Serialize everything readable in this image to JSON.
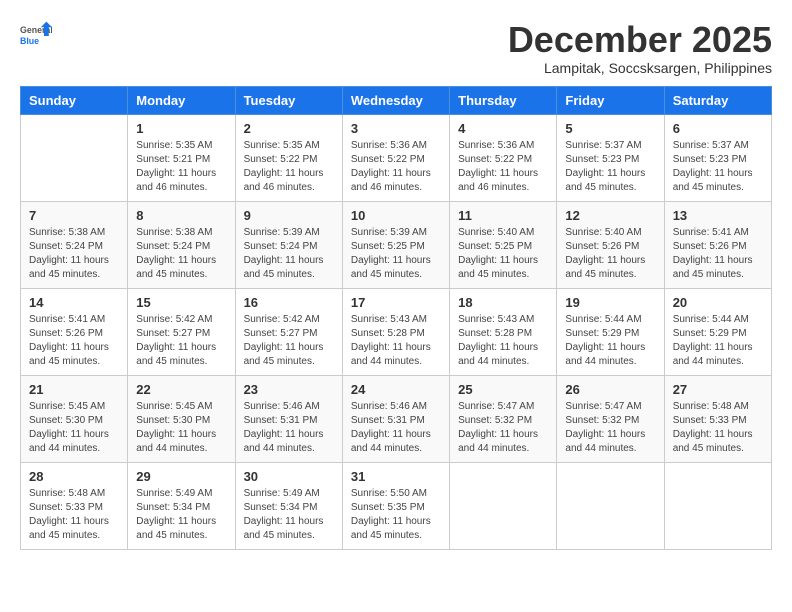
{
  "logo": {
    "general": "General",
    "blue": "Blue"
  },
  "title": "December 2025",
  "location": "Lampitak, Soccsksargen, Philippines",
  "weekdays": [
    "Sunday",
    "Monday",
    "Tuesday",
    "Wednesday",
    "Thursday",
    "Friday",
    "Saturday"
  ],
  "weeks": [
    [
      {
        "day": "",
        "info": ""
      },
      {
        "day": "1",
        "info": "Sunrise: 5:35 AM\nSunset: 5:21 PM\nDaylight: 11 hours and 46 minutes."
      },
      {
        "day": "2",
        "info": "Sunrise: 5:35 AM\nSunset: 5:22 PM\nDaylight: 11 hours and 46 minutes."
      },
      {
        "day": "3",
        "info": "Sunrise: 5:36 AM\nSunset: 5:22 PM\nDaylight: 11 hours and 46 minutes."
      },
      {
        "day": "4",
        "info": "Sunrise: 5:36 AM\nSunset: 5:22 PM\nDaylight: 11 hours and 46 minutes."
      },
      {
        "day": "5",
        "info": "Sunrise: 5:37 AM\nSunset: 5:23 PM\nDaylight: 11 hours and 45 minutes."
      },
      {
        "day": "6",
        "info": "Sunrise: 5:37 AM\nSunset: 5:23 PM\nDaylight: 11 hours and 45 minutes."
      }
    ],
    [
      {
        "day": "7",
        "info": "Sunrise: 5:38 AM\nSunset: 5:24 PM\nDaylight: 11 hours and 45 minutes."
      },
      {
        "day": "8",
        "info": "Sunrise: 5:38 AM\nSunset: 5:24 PM\nDaylight: 11 hours and 45 minutes."
      },
      {
        "day": "9",
        "info": "Sunrise: 5:39 AM\nSunset: 5:24 PM\nDaylight: 11 hours and 45 minutes."
      },
      {
        "day": "10",
        "info": "Sunrise: 5:39 AM\nSunset: 5:25 PM\nDaylight: 11 hours and 45 minutes."
      },
      {
        "day": "11",
        "info": "Sunrise: 5:40 AM\nSunset: 5:25 PM\nDaylight: 11 hours and 45 minutes."
      },
      {
        "day": "12",
        "info": "Sunrise: 5:40 AM\nSunset: 5:26 PM\nDaylight: 11 hours and 45 minutes."
      },
      {
        "day": "13",
        "info": "Sunrise: 5:41 AM\nSunset: 5:26 PM\nDaylight: 11 hours and 45 minutes."
      }
    ],
    [
      {
        "day": "14",
        "info": "Sunrise: 5:41 AM\nSunset: 5:26 PM\nDaylight: 11 hours and 45 minutes."
      },
      {
        "day": "15",
        "info": "Sunrise: 5:42 AM\nSunset: 5:27 PM\nDaylight: 11 hours and 45 minutes."
      },
      {
        "day": "16",
        "info": "Sunrise: 5:42 AM\nSunset: 5:27 PM\nDaylight: 11 hours and 45 minutes."
      },
      {
        "day": "17",
        "info": "Sunrise: 5:43 AM\nSunset: 5:28 PM\nDaylight: 11 hours and 44 minutes."
      },
      {
        "day": "18",
        "info": "Sunrise: 5:43 AM\nSunset: 5:28 PM\nDaylight: 11 hours and 44 minutes."
      },
      {
        "day": "19",
        "info": "Sunrise: 5:44 AM\nSunset: 5:29 PM\nDaylight: 11 hours and 44 minutes."
      },
      {
        "day": "20",
        "info": "Sunrise: 5:44 AM\nSunset: 5:29 PM\nDaylight: 11 hours and 44 minutes."
      }
    ],
    [
      {
        "day": "21",
        "info": "Sunrise: 5:45 AM\nSunset: 5:30 PM\nDaylight: 11 hours and 44 minutes."
      },
      {
        "day": "22",
        "info": "Sunrise: 5:45 AM\nSunset: 5:30 PM\nDaylight: 11 hours and 44 minutes."
      },
      {
        "day": "23",
        "info": "Sunrise: 5:46 AM\nSunset: 5:31 PM\nDaylight: 11 hours and 44 minutes."
      },
      {
        "day": "24",
        "info": "Sunrise: 5:46 AM\nSunset: 5:31 PM\nDaylight: 11 hours and 44 minutes."
      },
      {
        "day": "25",
        "info": "Sunrise: 5:47 AM\nSunset: 5:32 PM\nDaylight: 11 hours and 44 minutes."
      },
      {
        "day": "26",
        "info": "Sunrise: 5:47 AM\nSunset: 5:32 PM\nDaylight: 11 hours and 44 minutes."
      },
      {
        "day": "27",
        "info": "Sunrise: 5:48 AM\nSunset: 5:33 PM\nDaylight: 11 hours and 45 minutes."
      }
    ],
    [
      {
        "day": "28",
        "info": "Sunrise: 5:48 AM\nSunset: 5:33 PM\nDaylight: 11 hours and 45 minutes."
      },
      {
        "day": "29",
        "info": "Sunrise: 5:49 AM\nSunset: 5:34 PM\nDaylight: 11 hours and 45 minutes."
      },
      {
        "day": "30",
        "info": "Sunrise: 5:49 AM\nSunset: 5:34 PM\nDaylight: 11 hours and 45 minutes."
      },
      {
        "day": "31",
        "info": "Sunrise: 5:50 AM\nSunset: 5:35 PM\nDaylight: 11 hours and 45 minutes."
      },
      {
        "day": "",
        "info": ""
      },
      {
        "day": "",
        "info": ""
      },
      {
        "day": "",
        "info": ""
      }
    ]
  ]
}
